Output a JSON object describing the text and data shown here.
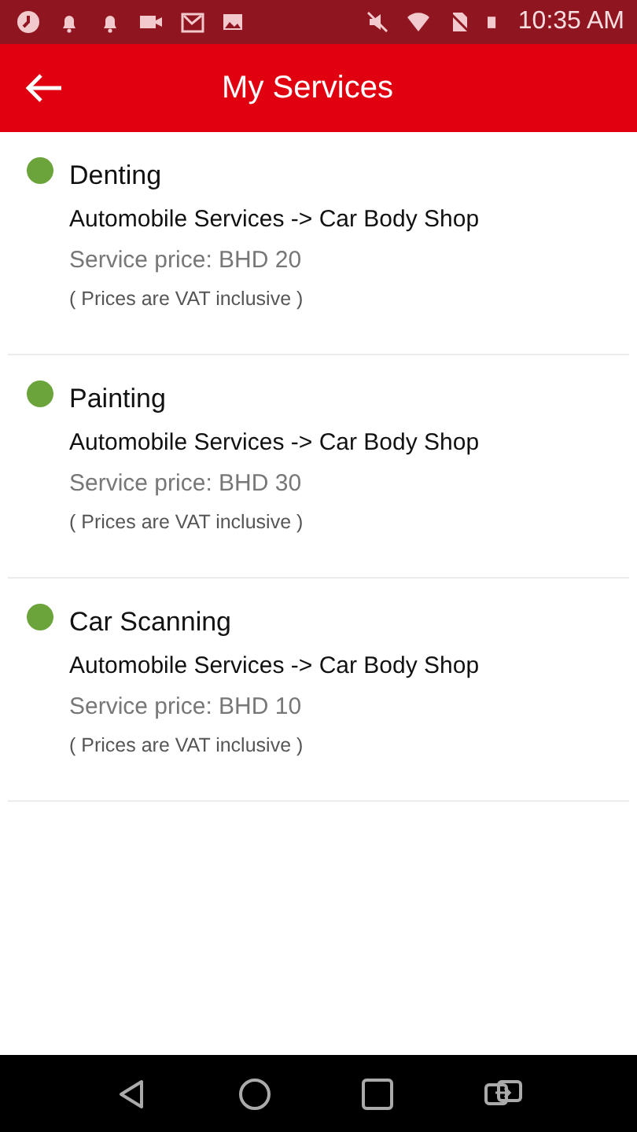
{
  "status_bar": {
    "time": "10:35 AM"
  },
  "header": {
    "title": "My Services"
  },
  "services": [
    {
      "name": "Denting",
      "color": "#6aa43a",
      "category": "Automobile Services -> Car Body Shop",
      "price": "Service price: BHD 20",
      "note": "( Prices are VAT inclusive )"
    },
    {
      "name": "Painting",
      "color": "#6aa43a",
      "category": "Automobile Services -> Car Body Shop",
      "price": "Service price: BHD 30",
      "note": "( Prices are VAT inclusive )"
    },
    {
      "name": "Car Scanning",
      "color": "#6aa43a",
      "category": "Automobile Services -> Car Body Shop",
      "price": "Service price: BHD 10",
      "note": "( Prices are VAT inclusive )"
    }
  ]
}
